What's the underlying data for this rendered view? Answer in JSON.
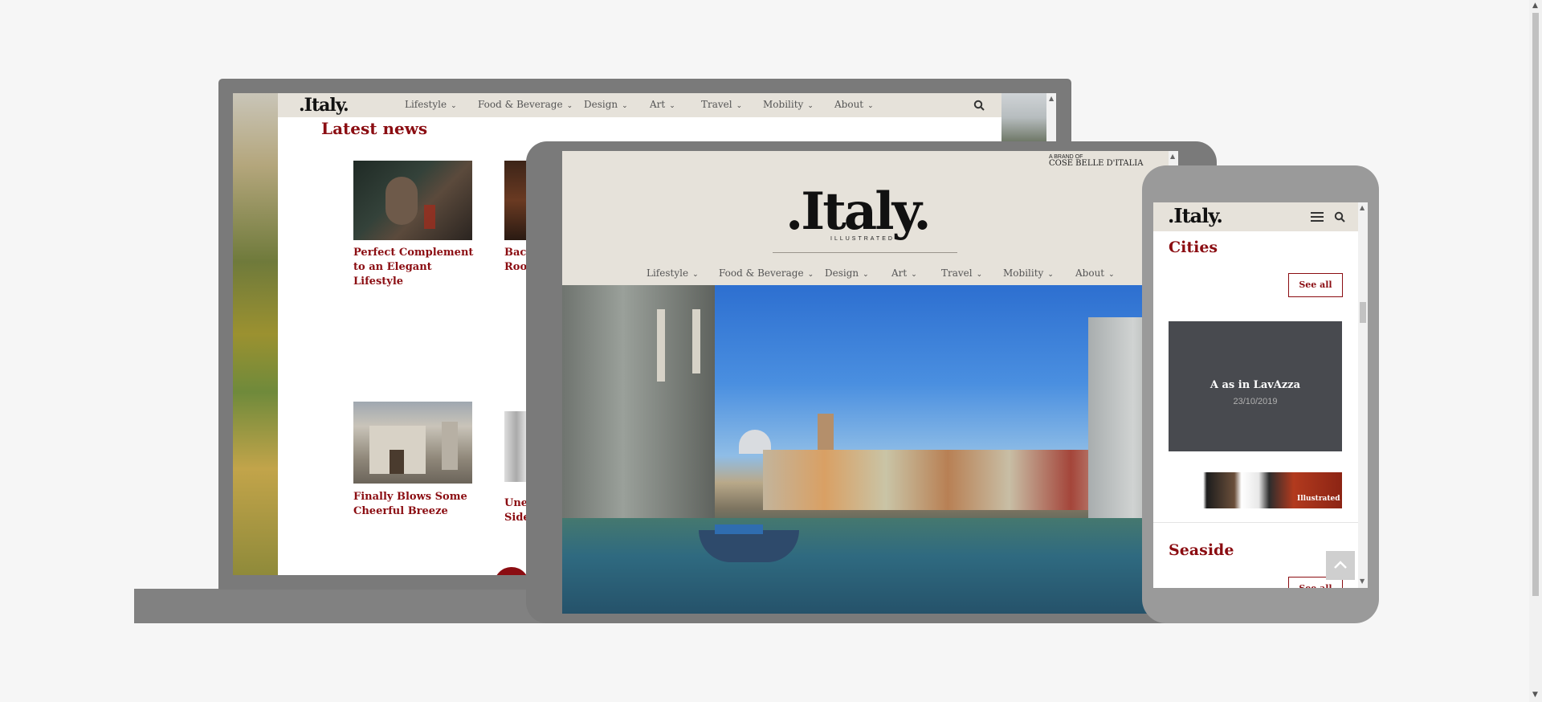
{
  "brand": {
    "logo_text": ".Italy.",
    "logo_sub": "ILLUSTRATED",
    "brand_of_line1": "A BRAND OF",
    "brand_of_line2": "COSE BELLE D'ITALIA"
  },
  "nav": {
    "items": [
      "Lifestyle",
      "Food & Beverage",
      "Design",
      "Art",
      "Travel",
      "Mobility",
      "About"
    ],
    "chevron": "⌵"
  },
  "laptop": {
    "section_title": "Latest news",
    "articles": [
      {
        "title": "Perfect Complement to an Elegant Lifestyle"
      },
      {
        "title": "Back to the Roots"
      },
      {
        "title": "Finally Blows Some Cheerful Breeze"
      },
      {
        "title": "Unexpected Sides"
      }
    ],
    "partial_article_2": "Bacl\nRoo",
    "partial_article_4": "Une\nSide"
  },
  "phone": {
    "section1_title": "Cities",
    "see_all": "See all",
    "card_title": "A as in LavAzza",
    "card_date": "23/10/2019",
    "banner_text": "Illustrated",
    "section2_title": "Seaside"
  },
  "colors": {
    "accent": "#8b0d12",
    "device": "#8c8c8c",
    "nav_bg": "#e6e2da"
  }
}
